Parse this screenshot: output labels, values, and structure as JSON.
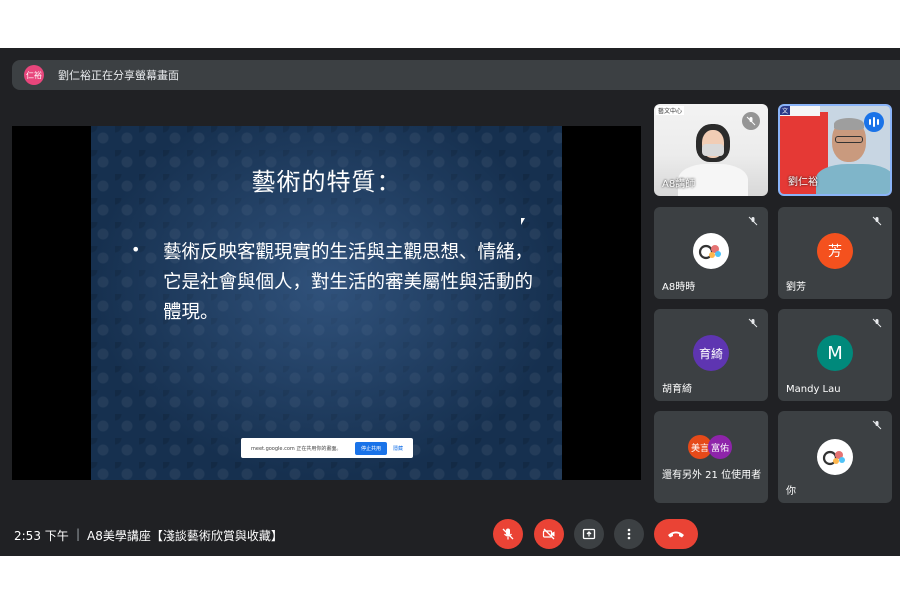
{
  "share_banner": {
    "avatar_text": "仁裕",
    "text": "劉仁裕正在分享螢幕畫面",
    "avatar_color": "#e8467c"
  },
  "slide": {
    "title": "藝術的特質：",
    "bullet": "•",
    "body": "藝術反映客觀現實的生活與主觀思想、情緒，它是社會與個人，對生活的審美屬性與活動的體現。"
  },
  "share_popup": {
    "text": "meet.google.com 正在共用你的畫面。",
    "stop_label": "停止共用",
    "hide_label": "隱藏"
  },
  "participants": {
    "video_a": {
      "name": "A8講師",
      "org_label": "藝文中心"
    },
    "video_b": {
      "name": "劉仁裕",
      "org_label": "文"
    },
    "a8": {
      "name": "A8時時"
    },
    "fang": {
      "name": "劉芳",
      "avatar": "芳",
      "color": "#f4511e"
    },
    "yuqi": {
      "name": "胡育綺",
      "avatar": "育綺",
      "color": "#5e35b1"
    },
    "mandy": {
      "name": "Mandy Lau",
      "avatar": "M",
      "color": "#00897b"
    },
    "others": {
      "name": "還有另外 21 位使用者",
      "avatar1": "美言",
      "avatar2": "富佑"
    },
    "you": {
      "name": "你"
    }
  },
  "toolbar": {
    "time": "2:53 下午",
    "separator": "|",
    "meeting_title": "A8美學講座【淺談藝術欣賞與收藏】"
  },
  "colors": {
    "accent": "#1a73e8",
    "danger": "#ea4335",
    "background": "#202124",
    "tile": "#3c4043"
  }
}
